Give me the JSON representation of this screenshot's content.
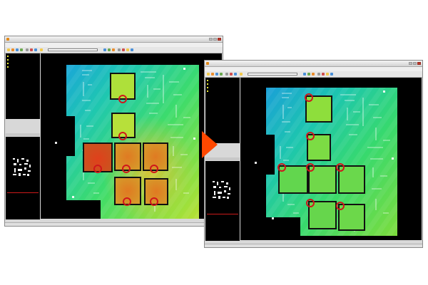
{
  "colors": {
    "accent_arrow": "#ff4800",
    "hotspot_ring": "#d0161b",
    "tree_text": "#e9e933",
    "thumb_line": "#cc1a1a"
  },
  "before": {
    "heat_level": "high",
    "packages": [
      "hot",
      "hot",
      "hot",
      "hot",
      "hot",
      "hot",
      "warm"
    ],
    "hotspot_rings": 7
  },
  "after": {
    "heat_level": "cool",
    "hotspot_rings": 7
  },
  "transition": {
    "icon": "arrow-right-icon"
  }
}
